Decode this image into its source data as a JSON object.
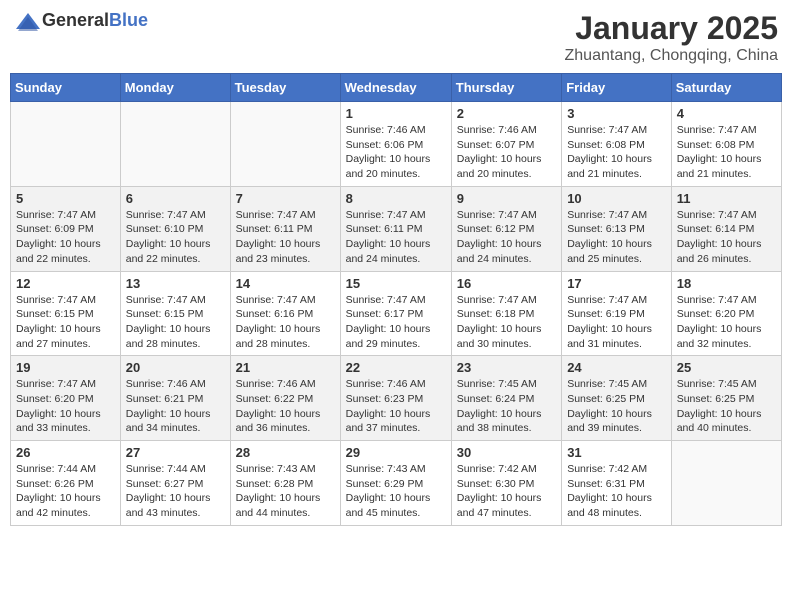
{
  "header": {
    "logo_general": "General",
    "logo_blue": "Blue",
    "month_title": "January 2025",
    "location": "Zhuantang, Chongqing, China"
  },
  "weekdays": [
    "Sunday",
    "Monday",
    "Tuesday",
    "Wednesday",
    "Thursday",
    "Friday",
    "Saturday"
  ],
  "weeks": [
    [
      {
        "day": "",
        "info": ""
      },
      {
        "day": "",
        "info": ""
      },
      {
        "day": "",
        "info": ""
      },
      {
        "day": "1",
        "info": "Sunrise: 7:46 AM\nSunset: 6:06 PM\nDaylight: 10 hours and 20 minutes."
      },
      {
        "day": "2",
        "info": "Sunrise: 7:46 AM\nSunset: 6:07 PM\nDaylight: 10 hours and 20 minutes."
      },
      {
        "day": "3",
        "info": "Sunrise: 7:47 AM\nSunset: 6:08 PM\nDaylight: 10 hours and 21 minutes."
      },
      {
        "day": "4",
        "info": "Sunrise: 7:47 AM\nSunset: 6:08 PM\nDaylight: 10 hours and 21 minutes."
      }
    ],
    [
      {
        "day": "5",
        "info": "Sunrise: 7:47 AM\nSunset: 6:09 PM\nDaylight: 10 hours and 22 minutes."
      },
      {
        "day": "6",
        "info": "Sunrise: 7:47 AM\nSunset: 6:10 PM\nDaylight: 10 hours and 22 minutes."
      },
      {
        "day": "7",
        "info": "Sunrise: 7:47 AM\nSunset: 6:11 PM\nDaylight: 10 hours and 23 minutes."
      },
      {
        "day": "8",
        "info": "Sunrise: 7:47 AM\nSunset: 6:11 PM\nDaylight: 10 hours and 24 minutes."
      },
      {
        "day": "9",
        "info": "Sunrise: 7:47 AM\nSunset: 6:12 PM\nDaylight: 10 hours and 24 minutes."
      },
      {
        "day": "10",
        "info": "Sunrise: 7:47 AM\nSunset: 6:13 PM\nDaylight: 10 hours and 25 minutes."
      },
      {
        "day": "11",
        "info": "Sunrise: 7:47 AM\nSunset: 6:14 PM\nDaylight: 10 hours and 26 minutes."
      }
    ],
    [
      {
        "day": "12",
        "info": "Sunrise: 7:47 AM\nSunset: 6:15 PM\nDaylight: 10 hours and 27 minutes."
      },
      {
        "day": "13",
        "info": "Sunrise: 7:47 AM\nSunset: 6:15 PM\nDaylight: 10 hours and 28 minutes."
      },
      {
        "day": "14",
        "info": "Sunrise: 7:47 AM\nSunset: 6:16 PM\nDaylight: 10 hours and 28 minutes."
      },
      {
        "day": "15",
        "info": "Sunrise: 7:47 AM\nSunset: 6:17 PM\nDaylight: 10 hours and 29 minutes."
      },
      {
        "day": "16",
        "info": "Sunrise: 7:47 AM\nSunset: 6:18 PM\nDaylight: 10 hours and 30 minutes."
      },
      {
        "day": "17",
        "info": "Sunrise: 7:47 AM\nSunset: 6:19 PM\nDaylight: 10 hours and 31 minutes."
      },
      {
        "day": "18",
        "info": "Sunrise: 7:47 AM\nSunset: 6:20 PM\nDaylight: 10 hours and 32 minutes."
      }
    ],
    [
      {
        "day": "19",
        "info": "Sunrise: 7:47 AM\nSunset: 6:20 PM\nDaylight: 10 hours and 33 minutes."
      },
      {
        "day": "20",
        "info": "Sunrise: 7:46 AM\nSunset: 6:21 PM\nDaylight: 10 hours and 34 minutes."
      },
      {
        "day": "21",
        "info": "Sunrise: 7:46 AM\nSunset: 6:22 PM\nDaylight: 10 hours and 36 minutes."
      },
      {
        "day": "22",
        "info": "Sunrise: 7:46 AM\nSunset: 6:23 PM\nDaylight: 10 hours and 37 minutes."
      },
      {
        "day": "23",
        "info": "Sunrise: 7:45 AM\nSunset: 6:24 PM\nDaylight: 10 hours and 38 minutes."
      },
      {
        "day": "24",
        "info": "Sunrise: 7:45 AM\nSunset: 6:25 PM\nDaylight: 10 hours and 39 minutes."
      },
      {
        "day": "25",
        "info": "Sunrise: 7:45 AM\nSunset: 6:25 PM\nDaylight: 10 hours and 40 minutes."
      }
    ],
    [
      {
        "day": "26",
        "info": "Sunrise: 7:44 AM\nSunset: 6:26 PM\nDaylight: 10 hours and 42 minutes."
      },
      {
        "day": "27",
        "info": "Sunrise: 7:44 AM\nSunset: 6:27 PM\nDaylight: 10 hours and 43 minutes."
      },
      {
        "day": "28",
        "info": "Sunrise: 7:43 AM\nSunset: 6:28 PM\nDaylight: 10 hours and 44 minutes."
      },
      {
        "day": "29",
        "info": "Sunrise: 7:43 AM\nSunset: 6:29 PM\nDaylight: 10 hours and 45 minutes."
      },
      {
        "day": "30",
        "info": "Sunrise: 7:42 AM\nSunset: 6:30 PM\nDaylight: 10 hours and 47 minutes."
      },
      {
        "day": "31",
        "info": "Sunrise: 7:42 AM\nSunset: 6:31 PM\nDaylight: 10 hours and 48 minutes."
      },
      {
        "day": "",
        "info": ""
      }
    ]
  ]
}
